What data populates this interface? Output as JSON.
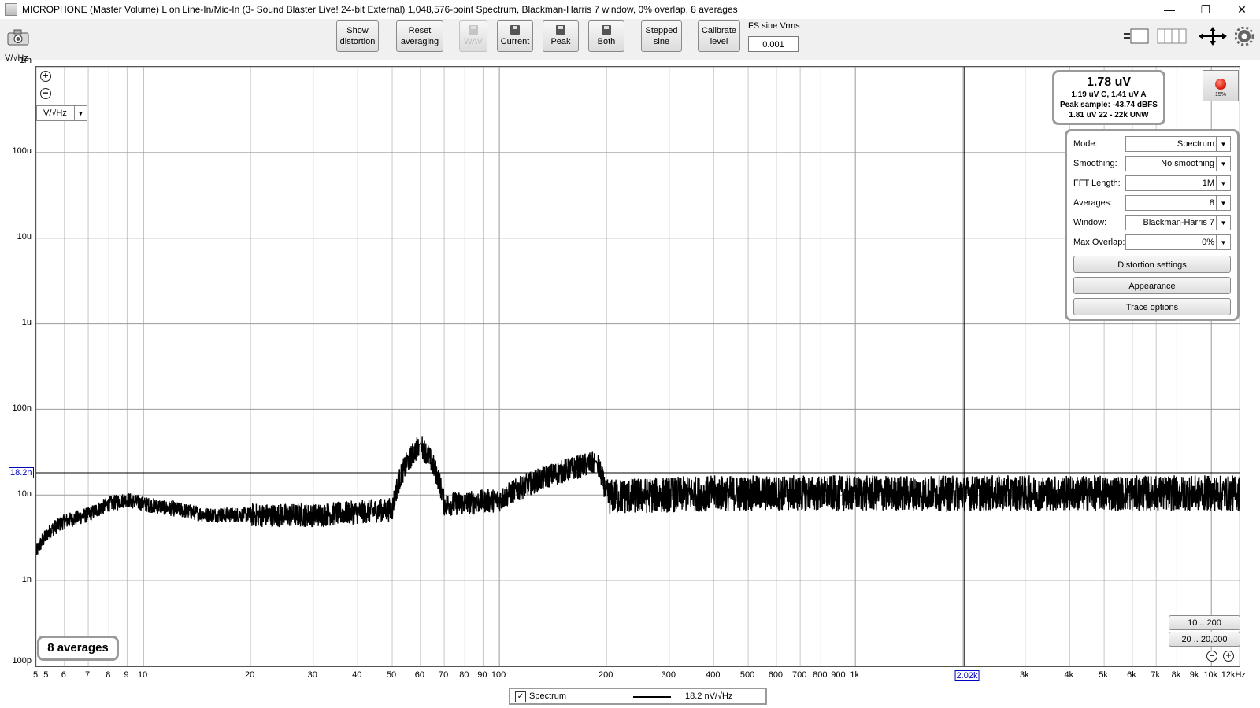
{
  "window": {
    "title": "MICROPHONE (Master Volume) L on Line-In/Mic-In (3- Sound Blaster Live! 24-bit External) 1,048,576-point Spectrum, Blackman-Harris 7 window, 0% overlap, 8 averages",
    "minimize": "—",
    "maximize": "❐",
    "close": "✕"
  },
  "toolbar": {
    "show_distortion": [
      "Show",
      "distortion"
    ],
    "reset_averaging": [
      "Reset",
      "averaging"
    ],
    "wav": "WAV",
    "current": "Current",
    "peak": "Peak",
    "both": "Both",
    "stepped_sine": [
      "Stepped",
      "sine"
    ],
    "calibrate_level": [
      "Calibrate",
      "level"
    ],
    "fs_sine_label": "FS sine Vrms",
    "fs_sine_value": "0.001"
  },
  "plot": {
    "y_unit": "V/√Hz",
    "unit_select": "V/√Hz",
    "y_ticks": [
      "1m",
      "100u",
      "10u",
      "1u",
      "100n",
      "10n",
      "1n",
      "100p"
    ],
    "x_ticks": [
      "5",
      "5",
      "6",
      "7",
      "8",
      "9",
      "10",
      "20",
      "30",
      "40",
      "50",
      "60",
      "70",
      "80",
      "90",
      "100",
      "200",
      "300",
      "400",
      "500",
      "600",
      "700",
      "800",
      "900",
      "1k",
      "3k",
      "4k",
      "5k",
      "6k",
      "7k",
      "8k",
      "9k",
      "10k",
      "12kHz"
    ],
    "cursor_x_label": "2.02k",
    "cursor_y_label": "18.2n",
    "x_axis": "log",
    "y_axis": "log",
    "grid": true
  },
  "readout": {
    "main": "1.78 uV",
    "line1": "1.19 uV C, 1.41 uV A",
    "line2": "Peak sample: -43.74 dBFS",
    "line3": "1.81 uV 22 - 22k UNW"
  },
  "record": {
    "percent": "15%"
  },
  "settings": {
    "mode_label": "Mode:",
    "mode_value": "Spectrum",
    "smoothing_label": "Smoothing:",
    "smoothing_value": "No  smoothing",
    "fft_label": "FFT Length:",
    "fft_value": "1M",
    "averages_label": "Averages:",
    "averages_value": "8",
    "window_label": "Window:",
    "window_value": "Blackman-Harris 7",
    "overlap_label": "Max Overlap:",
    "overlap_value": "0%",
    "distortion_settings": "Distortion settings",
    "appearance": "Appearance",
    "trace_options": "Trace options"
  },
  "averages_badge": "8 averages",
  "range_buttons": {
    "r1": "10 .. 200",
    "r2": "20 .. 20,000"
  },
  "legend": {
    "checked": "✓",
    "name": "Spectrum",
    "value": "18.2 nV/√Hz"
  },
  "chart_data": {
    "type": "line",
    "x_range": [
      5,
      12000
    ],
    "y_range": [
      "100p",
      "1m"
    ],
    "series": [
      {
        "name": "Spectrum",
        "x": [
          5,
          5.5,
          6,
          7,
          8,
          9,
          10,
          15,
          20,
          30,
          40,
          50,
          60,
          70,
          100,
          187,
          200,
          400,
          700,
          1000,
          2000,
          5000,
          12000
        ],
        "y_nV": [
          2.2,
          4,
          5,
          6,
          8,
          9,
          8,
          6,
          6,
          6,
          6.5,
          7,
          40,
          8,
          9,
          25,
          10,
          11,
          11,
          11,
          11,
          11,
          11
        ]
      }
    ]
  }
}
